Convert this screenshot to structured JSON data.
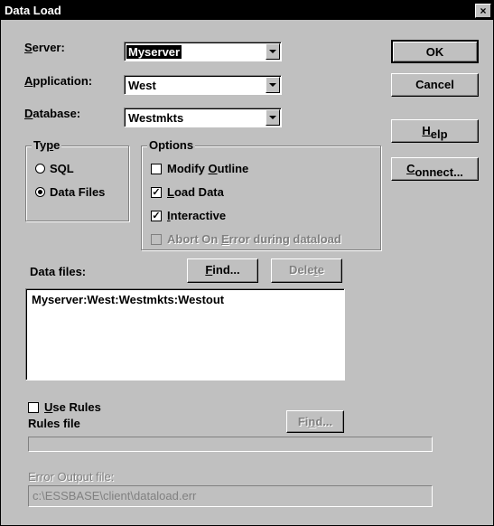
{
  "window": {
    "title": "Data Load",
    "close_glyph": "×"
  },
  "fields": {
    "server_label": "Server:",
    "server_value": "Myserver",
    "application_label": "Application:",
    "application_value": "West",
    "database_label": "Database:",
    "database_value": "Westmkts"
  },
  "buttons": {
    "ok": "OK",
    "cancel": "Cancel",
    "help": "Help",
    "connect": "Connect...",
    "find": "Find...",
    "delete": "Delete",
    "find_rules": "Find..."
  },
  "type_group": {
    "legend": "Type",
    "sql": "SQL",
    "data_files": "Data Files",
    "selected": "data_files"
  },
  "options_group": {
    "legend": "Options",
    "modify_outline": "Modify Outline",
    "modify_outline_checked": false,
    "load_data": "Load Data",
    "load_data_checked": true,
    "interactive": "Interactive",
    "interactive_checked": true,
    "abort_on_error": "Abort On Error during dataload",
    "abort_on_error_checked": false
  },
  "data_files": {
    "label": "Data files:",
    "items": [
      "Myserver:West:Westmkts:Westout"
    ]
  },
  "rules": {
    "use_rules_label": "Use Rules",
    "use_rules_checked": false,
    "rules_file_label": "Rules file",
    "rules_file_value": ""
  },
  "error_output": {
    "label": "Error Output file:",
    "value": "c:\\ESSBASE\\client\\dataload.err"
  }
}
